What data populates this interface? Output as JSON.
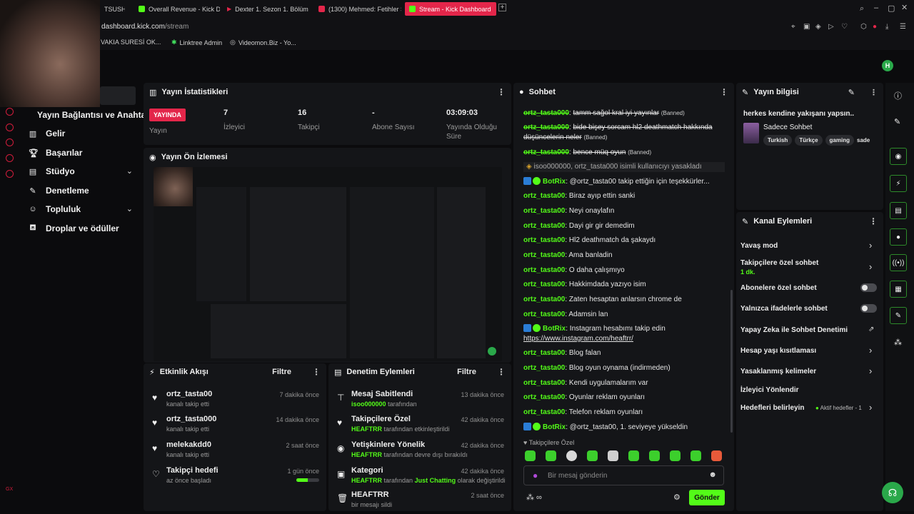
{
  "browser": {
    "tabs": [
      {
        "label": "TSUSH",
        "color": "#e3264a"
      },
      {
        "label": "Overall Revenue - Kick Da",
        "color": "#53fc18"
      },
      {
        "label": "Dexter 1. Sezon 1. Bölüm |",
        "color": "#e3264a"
      },
      {
        "label": "(1300) Mehmed: Fetihler S",
        "color": "#e3264a"
      },
      {
        "label": "Stream - Kick Dashboard",
        "color": "#53fc18"
      }
    ],
    "url_host": "dashboard.kick.com",
    "url_path": "/stream",
    "bookmarks": [
      "VAKIA SURESİ OK...",
      "Linktree Admin",
      "Videomon.Biz - Yo..."
    ]
  },
  "nav": {
    "items": [
      {
        "label": "Yayın Bağlantısı ve Anahtarı",
        "icon": "key-icon"
      },
      {
        "label": "Gelir",
        "icon": "chart-icon"
      },
      {
        "label": "Başarılar",
        "icon": "trophy-icon"
      },
      {
        "label": "Stüdyo",
        "icon": "studio-icon"
      },
      {
        "label": "Denetleme",
        "icon": "wrench-icon"
      },
      {
        "label": "Topluluk",
        "icon": "people-icon"
      },
      {
        "label": "Droplar ve ödüller",
        "icon": "gift-icon"
      }
    ]
  },
  "user_avatar_letter": "H",
  "stats": {
    "title": "Yayın İstatistikleri",
    "live_badge": "YAYINDA",
    "live_label": "Yayın",
    "viewers_value": "7",
    "viewers_label": "İzleyici",
    "followers_value": "16",
    "followers_label": "Takipçi",
    "subs_value": "-",
    "subs_label": "Abone Sayısı",
    "uptime_value": "03:09:03",
    "uptime_label": "Yayında Olduğu Süre"
  },
  "preview": {
    "title": "Yayın Ön İzlemesi"
  },
  "activity": {
    "title": "Etkinlik Akışı",
    "filter": "Filtre",
    "rows": [
      {
        "name": "ortz_tasta00",
        "desc": "kanalı takip etti",
        "time": "7 dakika önce"
      },
      {
        "name": "ortz_tasta000",
        "desc": "kanalı takip etti",
        "time": "14 dakika önce"
      },
      {
        "name": "melekakdd0",
        "desc": "kanalı takip etti",
        "time": "2 saat önce"
      },
      {
        "name": "Takipçi hedefi",
        "desc": "az önce başladı",
        "time": "1 gün önce"
      }
    ],
    "goal_progress": 0.5
  },
  "moderation": {
    "title": "Denetim Eylemleri",
    "filter": "Filtre",
    "rows": [
      {
        "title": "Mesaj Sabitlendi",
        "actor": "isoo000000",
        "rest": "tarafından",
        "time": "13 dakika önce"
      },
      {
        "title": "Takipçilere Özel",
        "actor": "HEAFTRR",
        "rest": "tarafından etkinleştirildi",
        "time": "42 dakika önce"
      },
      {
        "title": "Yetişkinlere Yönelik",
        "actor": "HEAFTRR",
        "rest": "tarafından devre dışı bırakıldı",
        "time": "42 dakika önce"
      },
      {
        "title": "Kategori",
        "actor": "HEAFTRR",
        "rest": "tarafından",
        "extra": "Just Chatting",
        "rest2": "olarak değiştirildi",
        "time": "42 dakika önce"
      },
      {
        "title": "HEAFTRR",
        "actor": "",
        "rest": "bir mesajı sildi",
        "time": "2 saat önce"
      }
    ]
  },
  "chat": {
    "title": "Sohbet",
    "lines": [
      {
        "user": "ortz_tasta000",
        "msg": "tamm sağol kral iyi yayınlar",
        "tag": "(Banned)",
        "kind": "banned"
      },
      {
        "user": "ortz_tasta000",
        "msg": "bide bişey sorcam hl2 deathmatch hakkında",
        "kind": "banned"
      },
      {
        "user": "",
        "msg": "düşüncelerin neler",
        "tag": "(Banned)",
        "kind": "banned-cont"
      },
      {
        "user": "ortz_tasta000",
        "msg": "bence müq oyun",
        "tag": "(Banned)",
        "kind": "banned"
      },
      {
        "user": "",
        "msg": "isoo000000, ortz_tasta000 isimli kullanıcıyı yasakladı",
        "kind": "sys"
      },
      {
        "user": "BotRix",
        "msg": "@ortz_tasta00 takip ettiğin için teşekkürler...",
        "kind": "bot"
      },
      {
        "user": "ortz_tasta00",
        "msg": "Biraz ayıp ettin sanki",
        "kind": "normal"
      },
      {
        "user": "ortz_tasta00",
        "msg": "Neyi onaylafın",
        "kind": "normal"
      },
      {
        "user": "ortz_tasta00",
        "msg": "Dayi gir gir demedim",
        "kind": "normal"
      },
      {
        "user": "ortz_tasta00",
        "msg": "Hl2 deathmatch da şakaydı",
        "kind": "normal"
      },
      {
        "user": "ortz_tasta00",
        "msg": "Ama banladin",
        "kind": "normal"
      },
      {
        "user": "ortz_tasta00",
        "msg": "O daha çalışmıyo",
        "kind": "normal"
      },
      {
        "user": "ortz_tasta00",
        "msg": "Hakkimdada yazıyo isim",
        "kind": "normal"
      },
      {
        "user": "ortz_tasta00",
        "msg": "Zaten hesaptan anlarsın chrome de",
        "kind": "normal"
      },
      {
        "user": "ortz_tasta00",
        "msg": "Adamsin lan",
        "kind": "normal"
      },
      {
        "user": "BotRix",
        "msg": "Instagram hesabımı takip edin",
        "kind": "bot"
      },
      {
        "user": "",
        "msg": "https://www.instagram.com/heaftrr/",
        "kind": "link"
      },
      {
        "user": "ortz_tasta00",
        "msg": "Blog falan",
        "kind": "normal"
      },
      {
        "user": "ortz_tasta00",
        "msg": "Blog oyun oynama (indirmeden)",
        "kind": "normal"
      },
      {
        "user": "ortz_tasta00",
        "msg": "Kendi uygulamalarım var",
        "kind": "normal"
      },
      {
        "user": "ortz_tasta00",
        "msg": "Oyunlar reklam oyunları",
        "kind": "normal"
      },
      {
        "user": "ortz_tasta00",
        "msg": "Telefon reklam oyunları",
        "kind": "normal"
      },
      {
        "user": "BotRix",
        "msg": "@ortz_tasta00, 1. seviyeye yükseldin",
        "kind": "bot"
      }
    ],
    "followers_only_label": "Takipçilere Özel",
    "input_placeholder": "Bir mesaj gönderin",
    "send_label": "Gönder"
  },
  "stream_info": {
    "title": "Yayın bilgisi",
    "stream_title": "herkes kendine yakışanı yapsın..",
    "category": "Sadece Sohbet",
    "tags": [
      "Turkish",
      "Türkçe",
      "gaming",
      "sade"
    ]
  },
  "channel_actions": {
    "title": "Kanal Eylemleri",
    "slow_mode": "Yavaş mod",
    "followers_only": "Takipçilere özel sohbet",
    "followers_only_value": "1 dk.",
    "subs_only": "Abonelere özel sohbet",
    "emotes_only": "Yalnızca ifadelerle sohbet",
    "ai_moderation": "Yapay Zeka ile Sohbet Denetimi",
    "age_restriction": "Hesap yaşı kısıtlaması",
    "banned_words": "Yasaklanmış kelimeler",
    "redirect_viewers": "İzleyici Yönlendir",
    "set_goals": "Hedefleri belirleyin",
    "active_goals": "Aktif hedefler - 1"
  },
  "colors": {
    "accent": "#53fc18",
    "live": "#e3264a",
    "panel": "#141518"
  }
}
